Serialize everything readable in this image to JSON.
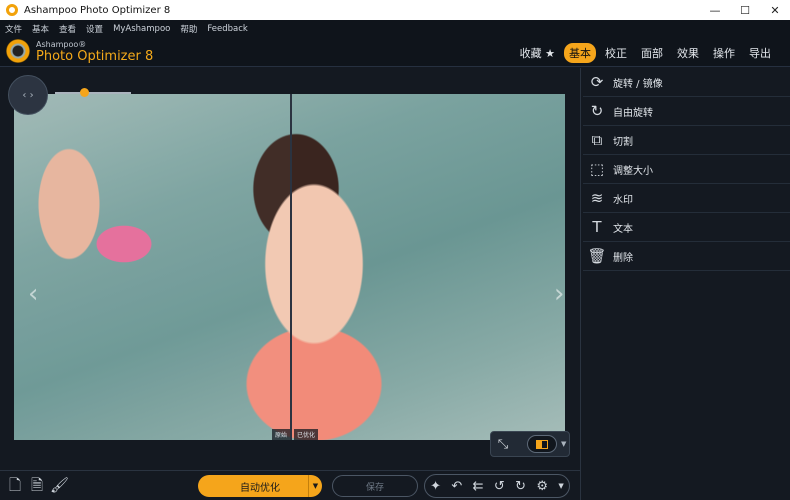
{
  "window": {
    "title": "Ashampoo Photo Optimizer 8",
    "min": "—",
    "max": "☐",
    "close": "✕"
  },
  "menu": [
    "文件",
    "基本",
    "查看",
    "设置",
    "MyAshampoo",
    "帮助",
    "Feedback"
  ],
  "brand": {
    "line1": "Ashampoo®",
    "line2": "Photo Optimizer 8"
  },
  "topnav": [
    {
      "label": "收藏 ★",
      "active": false
    },
    {
      "label": "基本",
      "active": true
    },
    {
      "label": "校正",
      "active": false
    },
    {
      "label": "面部",
      "active": false
    },
    {
      "label": "效果",
      "active": false
    },
    {
      "label": "操作",
      "active": false
    },
    {
      "label": "导出",
      "active": false
    }
  ],
  "viewer": {
    "split_labels": [
      "原始",
      "已优化"
    ],
    "zoom_level": 0.33
  },
  "bottom": {
    "auto_label": "自动优化",
    "save_label": "保存"
  },
  "panel": [
    {
      "icon": "rotate-icon",
      "glyph": "⟳",
      "label": "旋转 / 镜像"
    },
    {
      "icon": "free-rotate-icon",
      "glyph": "↻",
      "label": "自由旋转"
    },
    {
      "icon": "crop-icon",
      "glyph": "⧉",
      "label": "切割"
    },
    {
      "icon": "resize-icon",
      "glyph": "⬚",
      "label": "调整大小"
    },
    {
      "icon": "watermark-icon",
      "glyph": "≋",
      "label": "水印"
    },
    {
      "icon": "text-icon",
      "glyph": "T",
      "label": "文本"
    },
    {
      "icon": "delete-icon",
      "glyph": "🗑",
      "label": "删除"
    }
  ],
  "colors": {
    "accent": "#f5a51b",
    "background": "#141921"
  }
}
